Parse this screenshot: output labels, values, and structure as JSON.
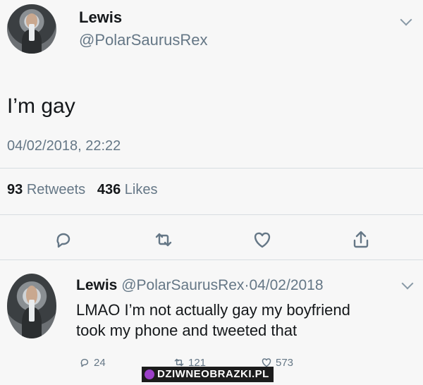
{
  "tweet": {
    "display_name": "Lewis",
    "handle": "@PolarSaurusRex",
    "text": "I’m gay",
    "timestamp": "04/02/2018, 22:22",
    "retweets_count": "93",
    "retweets_label": "Retweets",
    "likes_count": "436",
    "likes_label": "Likes"
  },
  "reply": {
    "display_name": "Lewis",
    "handle": "@PolarSaurusRex",
    "separator": "·",
    "date": "04/02/2018",
    "text_line1": "LMAO I’m not actually gay my boyfriend",
    "text_line2": "took my phone and tweeted that",
    "replies": "24",
    "retweets": "121",
    "likes": "573"
  },
  "watermark": {
    "text": "DZIWNEOBRAZKI.PL",
    "color": "#9b3fc8"
  },
  "icons": [
    "chevron-down-icon",
    "reply-icon",
    "retweet-icon",
    "heart-icon",
    "share-icon"
  ],
  "colors": {
    "background": "#f7f7f7",
    "text": "#14171a",
    "secondary": "#657786",
    "divider": "#d7dde1"
  }
}
